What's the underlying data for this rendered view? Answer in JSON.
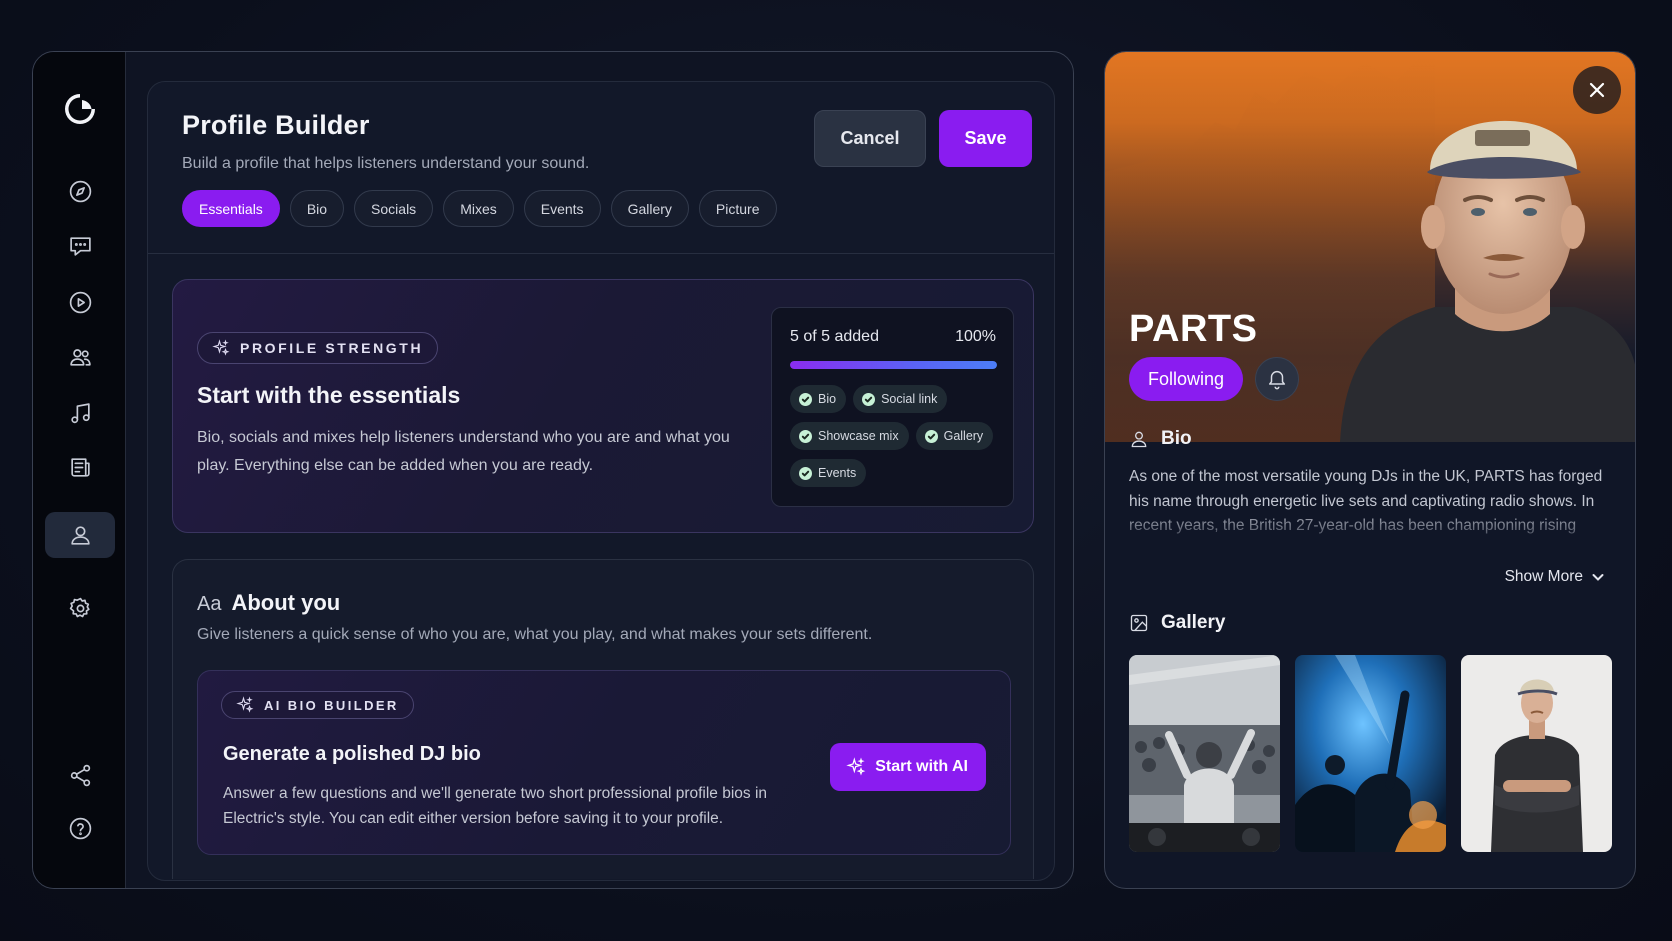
{
  "sidebar": {
    "items": [
      {
        "name": "logo-icon"
      },
      {
        "name": "compass-icon"
      },
      {
        "name": "chat-icon"
      },
      {
        "name": "play-icon"
      },
      {
        "name": "users-icon"
      },
      {
        "name": "music-note-icon"
      },
      {
        "name": "newspaper-icon"
      },
      {
        "name": "profile-icon",
        "active": true
      },
      {
        "name": "gear-icon"
      },
      {
        "name": "share-icon"
      },
      {
        "name": "help-icon"
      }
    ]
  },
  "builder": {
    "title": "Profile Builder",
    "subtitle": "Build a profile that helps listeners understand your sound.",
    "cancel_label": "Cancel",
    "save_label": "Save",
    "tabs": [
      "Essentials",
      "Bio",
      "Socials",
      "Mixes",
      "Events",
      "Gallery",
      "Picture"
    ],
    "active_tab": "Essentials"
  },
  "strength": {
    "label": "PROFILE STRENGTH",
    "heading": "Start with the essentials",
    "body": "Bio, socials and mixes help listeners understand who you are and what you play. Everything else can be added when you are ready.",
    "count_text": "5 of 5 added",
    "percent_text": "100%",
    "progress": 1.0,
    "chips": [
      "Bio",
      "Social link",
      "Showcase mix",
      "Gallery",
      "Events"
    ]
  },
  "about": {
    "aa": "Aa",
    "title": "About you",
    "subtitle": "Give listeners a quick sense of who you are, what you play, and what makes your sets different.",
    "ai_label": "AI BIO BUILDER",
    "ai_heading": "Generate a polished DJ bio",
    "ai_body": "Answer a few questions and we'll generate two short professional profile bios in Electric's style. You can edit either version before saving it to your profile.",
    "ai_button": "Start with AI"
  },
  "artist": {
    "name": "PARTS",
    "follow_label": "Following",
    "bio_heading": "Bio",
    "bio_text": "As one of the most versatile young DJs in the UK, PARTS has forged his name through energetic live sets and captivating radio shows. In recent years, the British 27-year-old has been championing rising",
    "show_more": "Show More",
    "gallery_heading": "Gallery"
  },
  "colors": {
    "accent": "#8a1cf0",
    "background": "#0b0f1c",
    "panel": "#121829"
  }
}
